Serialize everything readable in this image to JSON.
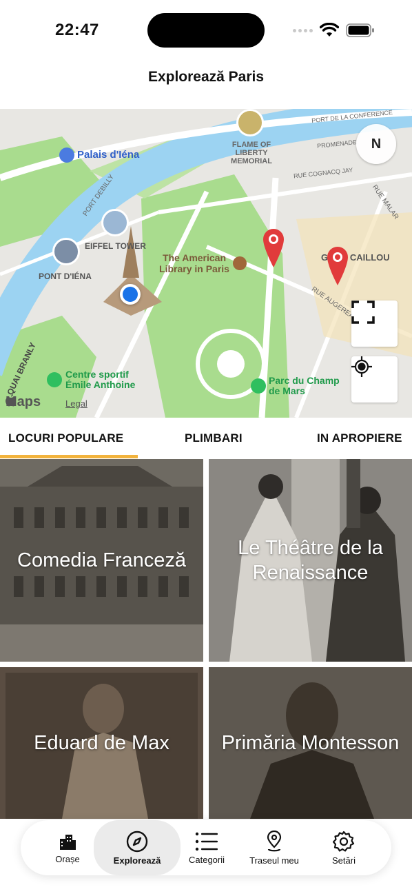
{
  "status_bar": {
    "time": "22:47"
  },
  "nav": {
    "title": "Explorează Paris"
  },
  "map": {
    "labels": {
      "palais": "Palais d'Iéna",
      "flame": "FLAME OF\nLIBERTY\nMEMORIAL",
      "eiffel": "EIFFEL TOWER",
      "pont": "PONT D'IÉNA",
      "library": "The American\nLibrary in Paris",
      "gros_caillou": "GROS CAILLOU",
      "centre": "Centre sportif\nÉmile Anthoine",
      "parc": "Parc du Champ\nde Mars",
      "port_debilly": "PORT DEBILLY",
      "conference": "PORT DE LA CONFERENCE",
      "promenade": "PROMENADE",
      "cognacq": "RUE COGNACQ JAY",
      "augereau": "RUE AUGEREAU",
      "malar": "RUE MALAR",
      "branly": "QUAI BRANLY"
    },
    "compass_label": "N",
    "brand": "Maps",
    "legal": "Legal"
  },
  "tabs": [
    {
      "label": "LOCURI POPULARE",
      "active": true
    },
    {
      "label": "PLIMBARI",
      "active": false
    },
    {
      "label": "IN APROPIERE",
      "active": false
    }
  ],
  "places": [
    {
      "title": "Comedia Franceză"
    },
    {
      "title": "Le Théâtre de la Renaissance"
    },
    {
      "title": "Eduard de Max"
    },
    {
      "title": "Primăria Montesson"
    }
  ],
  "tabbar": [
    {
      "label": "Orașe",
      "icon": "buildings-icon"
    },
    {
      "label": "Explorează",
      "icon": "compass-icon",
      "active": true
    },
    {
      "label": "Categorii",
      "icon": "list-icon"
    },
    {
      "label": "Traseul meu",
      "icon": "map-pin-route-icon"
    },
    {
      "label": "Setări",
      "icon": "gear-icon"
    }
  ],
  "colors": {
    "accent": "#f2b33d",
    "river": "#9cd3f2",
    "park": "#a9dc8e",
    "pin": "#e13b3b",
    "user_location": "#1a73e8"
  }
}
